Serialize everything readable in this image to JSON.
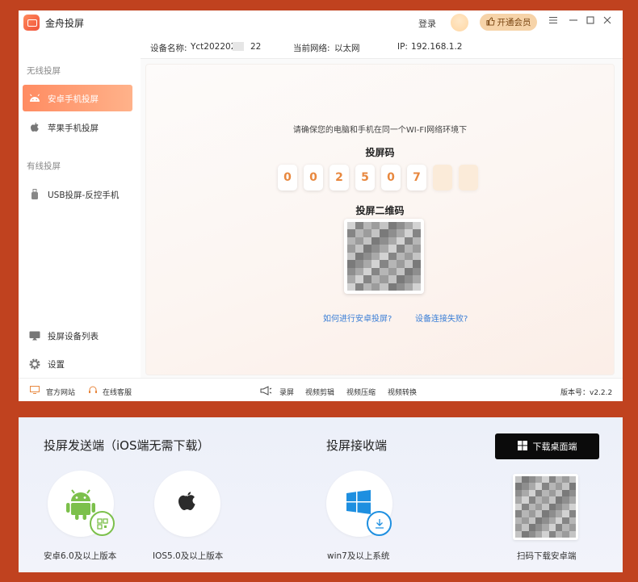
{
  "app": {
    "title": "金舟投屏",
    "login_label": "登录",
    "vip_label": "开通会员",
    "window_buttons": [
      "menu-icon",
      "minimize-icon",
      "maximize-icon",
      "close-icon"
    ]
  },
  "info_bar": {
    "device_label": "设备名称:",
    "device_name_prefix": "Yct202202",
    "device_name_suffix": "22",
    "network_label": "当前网络:",
    "network_value": "以太网",
    "ip_label": "IP:",
    "ip_value": "192.168.1.2"
  },
  "sidebar": {
    "wireless_section": "无线投屏",
    "wired_section": "有线投屏",
    "items": [
      {
        "label": "安卓手机投屏",
        "icon": "android-icon",
        "active": true
      },
      {
        "label": "苹果手机投屏",
        "icon": "apple-icon",
        "active": false
      },
      {
        "label": "USB投屏-反控手机",
        "icon": "usb-phone-icon",
        "active": false
      },
      {
        "label": "投屏设备列表",
        "icon": "monitor-icon",
        "active": false
      },
      {
        "label": "设置",
        "icon": "gear-icon",
        "active": false
      }
    ]
  },
  "main": {
    "hint": "请确保您的电脑和手机在同一个WI-FI网络环境下",
    "code_title": "投屏码",
    "code_digits": [
      "0",
      "0",
      "2",
      "5",
      "0",
      "7",
      "",
      ""
    ],
    "qr_title": "投屏二维码",
    "link_how": "如何进行安卓投屏?",
    "link_fail": "设备连接失败?"
  },
  "status_bar": {
    "website": "官方网站",
    "support": "在线客服",
    "record": "录屏",
    "video_edit": "视频剪辑",
    "video_compress": "视频压缩",
    "video_convert": "视频转换",
    "version": "版本号：v2.2.2"
  },
  "panel": {
    "sender_title": "投屏发送端（iOS端无需下载）",
    "receiver_title": "投屏接收端",
    "download_button": "下载桌面端",
    "android_label": "安卓6.0及以上版本",
    "ios_label": "IOS5.0及以上版本",
    "windows_label": "win7及以上系统",
    "qr_label": "扫码下载安卓端"
  },
  "colors": {
    "background": "#c0421f",
    "accent": "#ff8c62",
    "digit": "#e8883f",
    "link": "#3a7ed6",
    "android_green": "#7cc04b",
    "windows_blue": "#1e8fe0"
  }
}
